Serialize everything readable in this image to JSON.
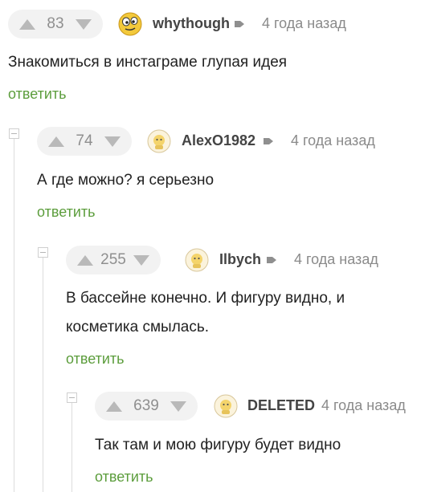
{
  "comments": [
    {
      "score": "83",
      "author": "whythough",
      "time": "4 года назад",
      "text_lines": [
        "Знакомиться в инстаграме глупая идея"
      ],
      "reply_label": "ответить",
      "avatar_icon": "smiley-face-icon"
    },
    {
      "score": "74",
      "author": "AlexO1982",
      "time": "4 года назад",
      "text_lines": [
        "А где можно? я серьезно"
      ],
      "reply_label": "ответить",
      "avatar_icon": "default-avatar-icon"
    },
    {
      "score": "255",
      "author": "Ilbych",
      "time": "4 года назад",
      "text_lines": [
        "В бассейне конечно. И фигуру видно, и",
        "косметика смылась."
      ],
      "reply_label": "ответить",
      "avatar_icon": "default-avatar-icon"
    },
    {
      "score": "639",
      "author": "DELETED",
      "time": "4 года назад",
      "text_lines": [
        "Так там и мою фигуру будет видно"
      ],
      "reply_label": "ответить",
      "avatar_icon": "default-avatar-icon"
    }
  ],
  "colors": {
    "accent": "#5c9d3c",
    "vote_bg": "#f2f2f2",
    "muted": "#8a8a8a"
  }
}
